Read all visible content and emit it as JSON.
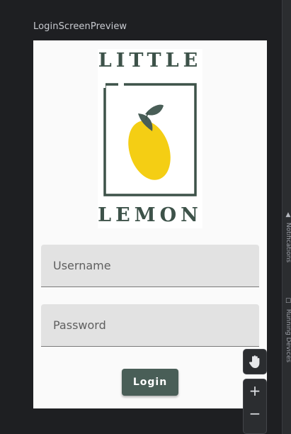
{
  "preview": {
    "title": "LoginScreenPreview"
  },
  "logo": {
    "top_word": "LITTLE",
    "bottom_word": "LEMON",
    "colors": {
      "text": "#3d5249",
      "lemon": "#f4ce14",
      "leaf": "#495e57"
    }
  },
  "form": {
    "username_label": "Username",
    "password_label": "Password",
    "login_label": "Login"
  },
  "ide": {
    "side_tabs": [
      {
        "label": "Notifications",
        "icon": "bell-icon"
      },
      {
        "label": "Running Devices",
        "icon": "device-icon"
      }
    ],
    "tools": [
      {
        "name": "pan",
        "icon": "hand-icon"
      },
      {
        "name": "zoom-in",
        "icon": "plus-icon",
        "glyph": "+"
      },
      {
        "name": "zoom-out",
        "icon": "minus-icon",
        "glyph": "−"
      }
    ]
  },
  "colors": {
    "ide_background": "#1e1f22",
    "button": "#495e57",
    "field": "#e2e2e2"
  }
}
